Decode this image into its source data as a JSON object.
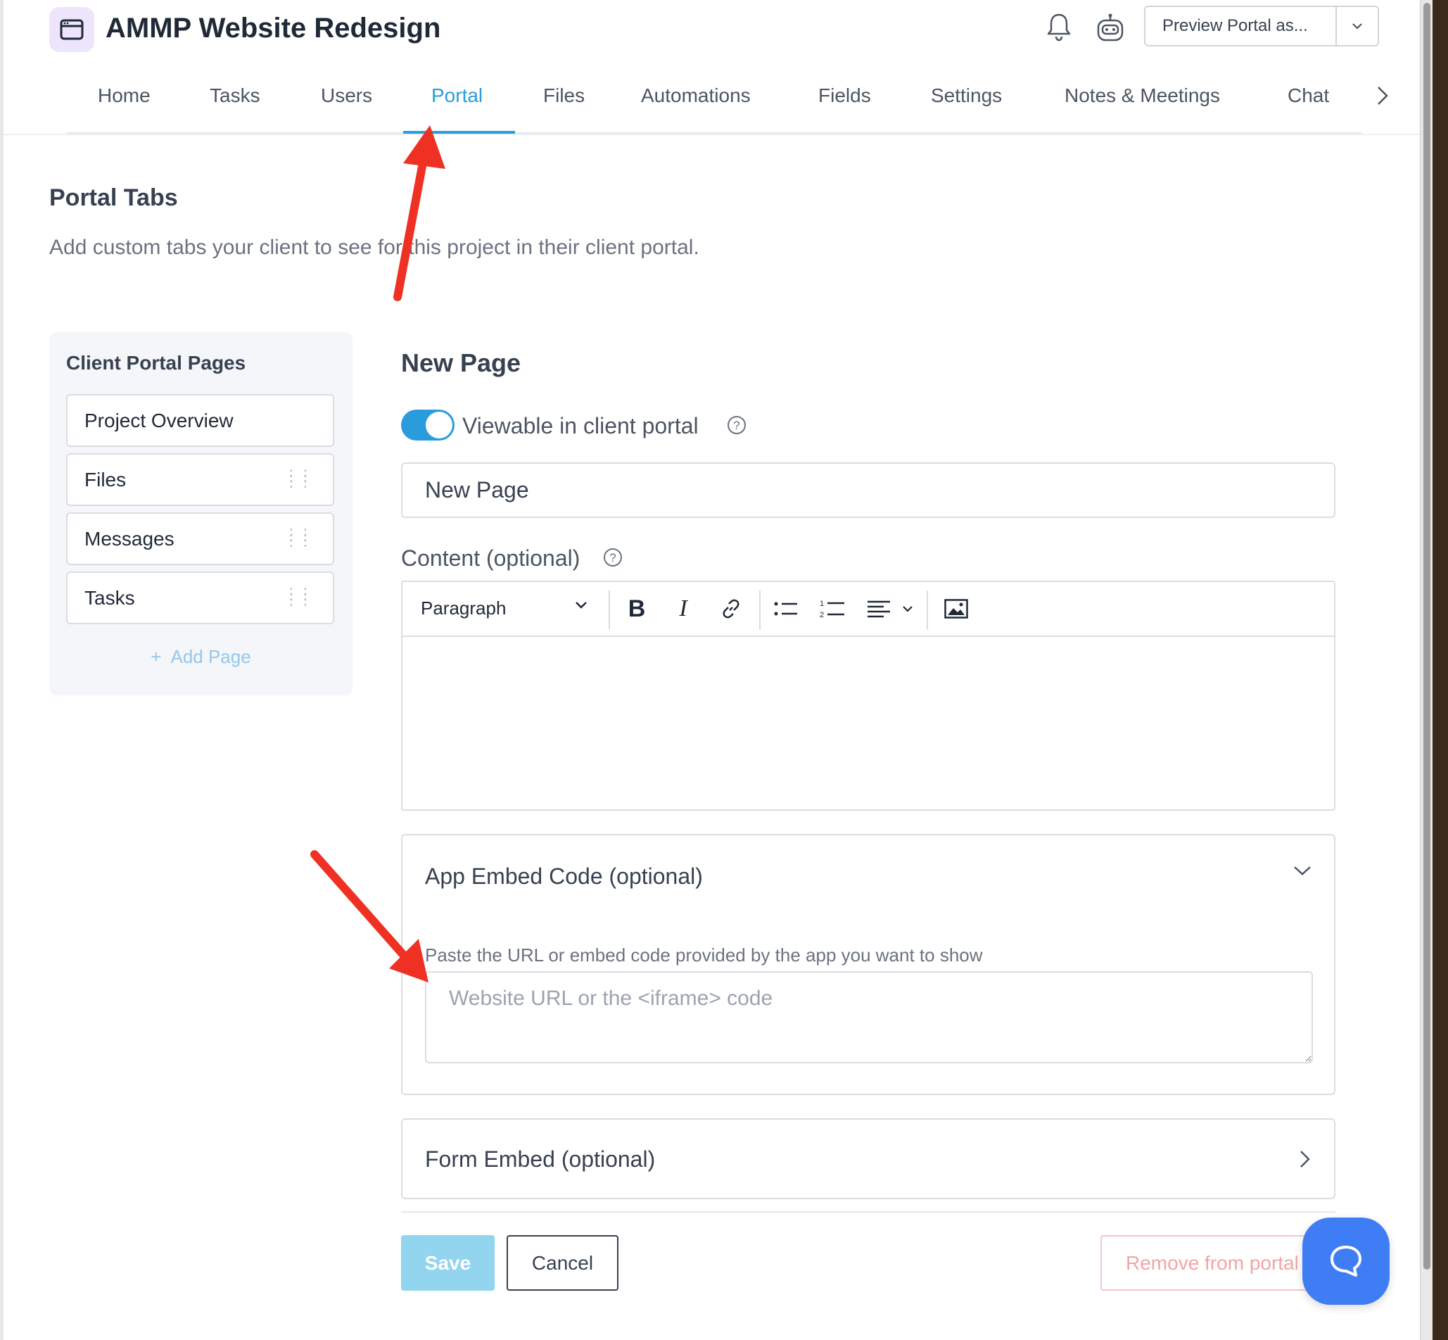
{
  "header": {
    "project_title": "AMMP Website Redesign",
    "preview_button": "Preview Portal as..."
  },
  "tabs": [
    {
      "label": "Home",
      "active": false
    },
    {
      "label": "Tasks",
      "active": false
    },
    {
      "label": "Users",
      "active": false
    },
    {
      "label": "Portal",
      "active": true
    },
    {
      "label": "Files",
      "active": false
    },
    {
      "label": "Automations",
      "active": false
    },
    {
      "label": "Fields",
      "active": false
    },
    {
      "label": "Settings",
      "active": false
    },
    {
      "label": "Notes & Meetings",
      "active": false
    },
    {
      "label": "Chat",
      "active": false
    }
  ],
  "section": {
    "title": "Portal Tabs",
    "description": "Add custom tabs your client to see for this project in their client portal."
  },
  "sidebar": {
    "title": "Client Portal Pages",
    "pages": [
      {
        "label": "Project Overview"
      },
      {
        "label": "Files"
      },
      {
        "label": "Messages"
      },
      {
        "label": "Tasks"
      }
    ],
    "add_page": "Add Page"
  },
  "form": {
    "title": "New Page",
    "viewable_label": "Viewable in client portal",
    "viewable_on": true,
    "page_name_value": "New Page",
    "content_label": "Content (optional)",
    "editor": {
      "block_style": "Paragraph"
    },
    "app_embed": {
      "title": "App Embed Code (optional)",
      "hint": "Paste the URL or embed code provided by the app you want to show",
      "placeholder": "Website URL or the <iframe> code",
      "expanded": true
    },
    "form_embed": {
      "title": "Form Embed (optional)",
      "expanded": false
    },
    "buttons": {
      "save": "Save",
      "cancel": "Cancel",
      "remove": "Remove from portal"
    }
  },
  "colors": {
    "accent": "#2b9cdb",
    "annotation_arrow": "#ef3124",
    "chat_bubble": "#3f7df5"
  }
}
